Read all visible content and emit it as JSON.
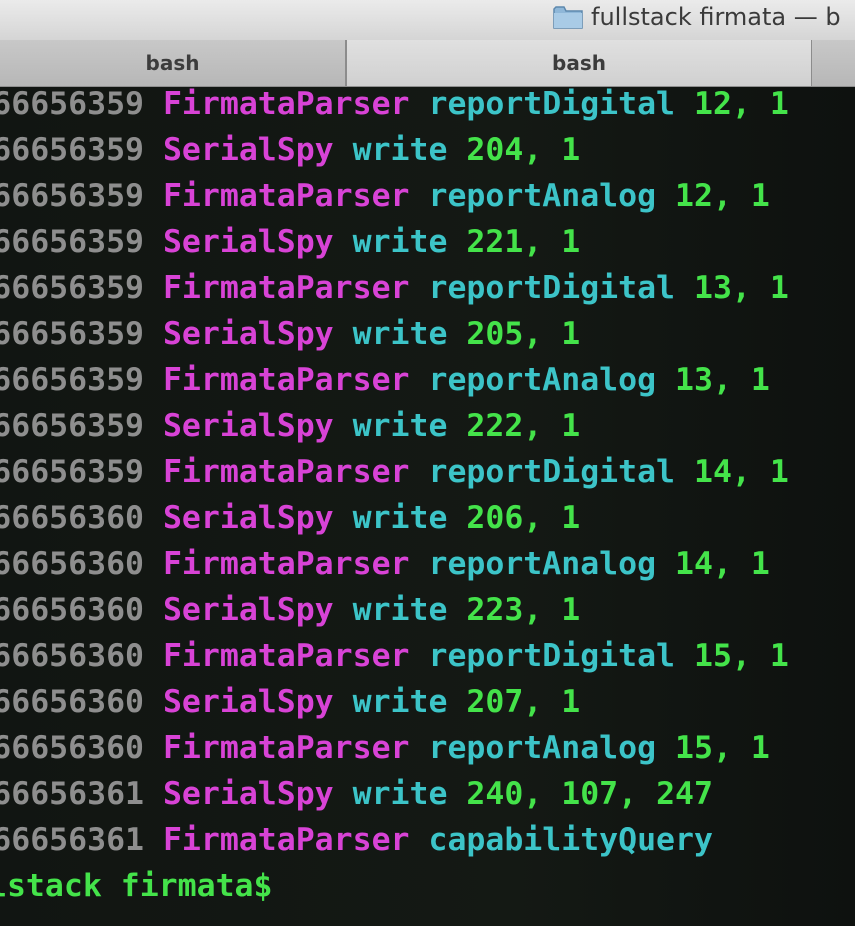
{
  "window": {
    "title": "fullstack firmata — b",
    "folder_icon": "folder-icon"
  },
  "tabs": [
    {
      "label": "bash",
      "active": false
    },
    {
      "label": "bash",
      "active": true
    }
  ],
  "terminal": {
    "lines": [
      {
        "ts": "66656359",
        "module": "FirmataParser",
        "fn": "reportDigital",
        "args": "12, 1"
      },
      {
        "ts": "66656359",
        "module": "SerialSpy",
        "fn": "write",
        "args": "204, 1"
      },
      {
        "ts": "66656359",
        "module": "FirmataParser",
        "fn": "reportAnalog",
        "args": "12, 1"
      },
      {
        "ts": "66656359",
        "module": "SerialSpy",
        "fn": "write",
        "args": "221, 1"
      },
      {
        "ts": "66656359",
        "module": "FirmataParser",
        "fn": "reportDigital",
        "args": "13, 1"
      },
      {
        "ts": "66656359",
        "module": "SerialSpy",
        "fn": "write",
        "args": "205, 1"
      },
      {
        "ts": "66656359",
        "module": "FirmataParser",
        "fn": "reportAnalog",
        "args": "13, 1"
      },
      {
        "ts": "66656359",
        "module": "SerialSpy",
        "fn": "write",
        "args": "222, 1"
      },
      {
        "ts": "66656359",
        "module": "FirmataParser",
        "fn": "reportDigital",
        "args": "14, 1"
      },
      {
        "ts": "66656360",
        "module": "SerialSpy",
        "fn": "write",
        "args": "206, 1"
      },
      {
        "ts": "66656360",
        "module": "FirmataParser",
        "fn": "reportAnalog",
        "args": "14, 1"
      },
      {
        "ts": "66656360",
        "module": "SerialSpy",
        "fn": "write",
        "args": "223, 1"
      },
      {
        "ts": "66656360",
        "module": "FirmataParser",
        "fn": "reportDigital",
        "args": "15, 1"
      },
      {
        "ts": "66656360",
        "module": "SerialSpy",
        "fn": "write",
        "args": "207, 1"
      },
      {
        "ts": "66656360",
        "module": "FirmataParser",
        "fn": "reportAnalog",
        "args": "15, 1"
      },
      {
        "ts": "66656361",
        "module": "SerialSpy",
        "fn": "write",
        "args": "240, 107, 247"
      },
      {
        "ts": "66656361",
        "module": "FirmataParser",
        "fn": "capabilityQuery",
        "args": ""
      }
    ],
    "prompt": "lstack firmata$"
  },
  "colors": {
    "timestamp": "#8e8e8e",
    "module": "#d843d6",
    "function": "#3cc4c8",
    "args": "#44e34a",
    "prompt": "#44e34a",
    "background": "#111512"
  }
}
